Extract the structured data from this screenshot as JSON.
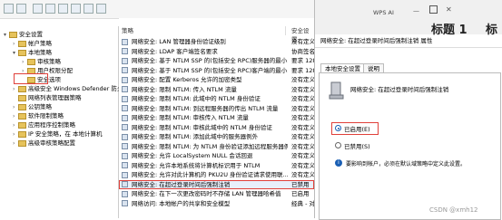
{
  "window": {
    "brand": "WPS AI",
    "overlay_text": "标题 1",
    "overlay_text2": "标"
  },
  "tree": {
    "items": [
      {
        "label": "安全设置",
        "level": 0,
        "toggle": "▾"
      },
      {
        "label": "帐户策略",
        "level": 1,
        "toggle": "›"
      },
      {
        "label": "本地策略",
        "level": 1,
        "toggle": "▾"
      },
      {
        "label": "审核策略",
        "level": 2,
        "toggle": "›"
      },
      {
        "label": "用户权限分配",
        "level": 2,
        "toggle": "›"
      },
      {
        "label": "安全选项",
        "level": 2,
        "toggle": ""
      },
      {
        "label": "高级安全 Windows Defender 防火墙",
        "level": 1,
        "toggle": "›"
      },
      {
        "label": "网络列表管理器策略",
        "level": 1,
        "toggle": ""
      },
      {
        "label": "公钥策略",
        "level": 1,
        "toggle": "›"
      },
      {
        "label": "软件限制策略",
        "level": 1,
        "toggle": "›"
      },
      {
        "label": "应用程序控制策略",
        "level": 1,
        "toggle": "›"
      },
      {
        "label": "IP 安全策略，在 本地计算机",
        "level": 1,
        "toggle": "›"
      },
      {
        "label": "高级审核策略配置",
        "level": 1,
        "toggle": "›"
      }
    ]
  },
  "list": {
    "col_policy": "策略",
    "col_setting": "安全设置",
    "rows": [
      {
        "name": "网络安全: LAN 管理器身份验证级别",
        "value": "没有定义"
      },
      {
        "name": "网络安全: LDAP 客户端签名要求",
        "value": "协商签名"
      },
      {
        "name": "网络安全: 基于 NTLM SSP 的(包括安全 RPC)服务器的最小...",
        "value": "要求 128"
      },
      {
        "name": "网络安全: 基于 NTLM SSP 的(包括安全 RPC)客户端的最小...",
        "value": "要求 128"
      },
      {
        "name": "网络安全: 配置 Kerberos 允许的加密类型",
        "value": "没有定义"
      },
      {
        "name": "网络安全: 限制 NTLM: 传入 NTLM 流量",
        "value": "没有定义"
      },
      {
        "name": "网络安全: 限制 NTLM: 此域中的 NTLM 身份验证",
        "value": "没有定义"
      },
      {
        "name": "网络安全: 限制 NTLM: 到远程服务器的传出 NTLM 流量",
        "value": "没有定义"
      },
      {
        "name": "网络安全: 限制 NTLM: 审核传入 NTLM 流量",
        "value": "没有定义"
      },
      {
        "name": "网络安全: 限制 NTLM: 审核此域中的 NTLM 身份验证",
        "value": "没有定义"
      },
      {
        "name": "网络安全: 限制 NTLM: 添加此域中的服务器例外",
        "value": "没有定义"
      },
      {
        "name": "网络安全: 限制 NTLM: 为 NTLM 身份验证添加远程服务器例外",
        "value": "没有定义"
      },
      {
        "name": "网络安全: 允许 LocalSystem NULL 会话回退",
        "value": "没有定义"
      },
      {
        "name": "网络安全: 允许本地系统将计算机标识用于 NTLM",
        "value": "没有定义"
      },
      {
        "name": "网络安全: 允许对此计算机的 PKU2U 身份验证请求使用联...",
        "value": "没有定义"
      },
      {
        "name": "网络安全: 在超过登录时间后强制注销",
        "value": "已禁用"
      },
      {
        "name": "网络安全: 在下一次更改密码时不存储 LAN 管理器哈希值",
        "value": "已启用"
      },
      {
        "name": "网络访问: 本地帐户的共享和安全模型",
        "value": "经典 - 对"
      }
    ]
  },
  "dialog": {
    "title": "网络安全: 在超过登录时间后强制注销 属性",
    "tabs": [
      "本地安全设置",
      "说明"
    ],
    "policy_name": "网络安全: 在超过登录时间后强制注销",
    "option_enabled": "已启用(E)",
    "option_disabled": "已禁用(S)",
    "selected": "enabled",
    "info": "要影响到帐户，必须在默认域策略中定义此设置。",
    "info_icon": "info-icon",
    "watermark": "CSDN @xmh12"
  },
  "colors": {
    "highlight": "#e0403a",
    "link": "#1a5fb4",
    "selection_bg": "#e8f0fb"
  }
}
